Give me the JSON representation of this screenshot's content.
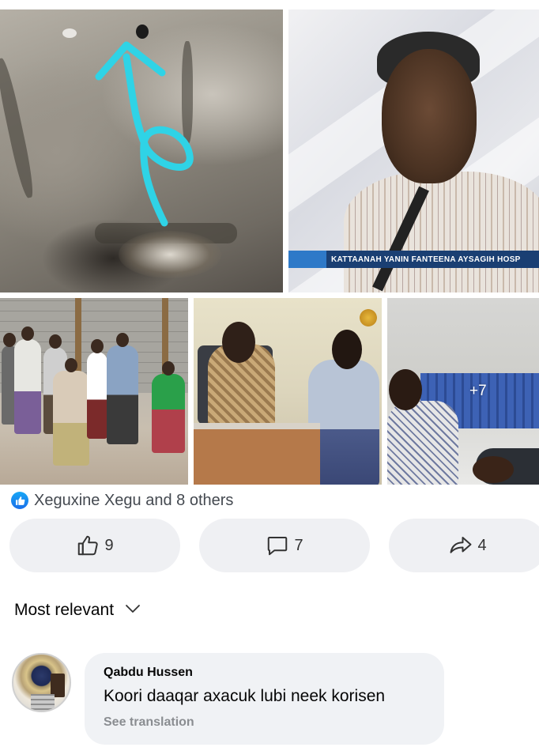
{
  "post": {
    "more_photos_count": "+7",
    "tv_ticker": "KATTAANAH YANIN FANTEENA AYSAGIH HOSP"
  },
  "reactions": {
    "summary": "Xeguxine Xegu and 8 others"
  },
  "actions": {
    "like_count": "9",
    "comment_count": "7",
    "share_count": "4"
  },
  "comments_section": {
    "sort_label": "Most relevant"
  },
  "comment": {
    "author": "Qabdu Hussen",
    "text": "Koori daaqar axacuk lubi neek korisen",
    "translate_label": "See translation"
  },
  "colors": {
    "like_blue": "#1877f2",
    "bubble_bg": "#f0f2f5",
    "button_bg": "#eff0f3",
    "arrow_cyan": "#2fd3e6"
  },
  "icons": {
    "like": "thumbs-up-icon",
    "comment": "speech-bubble-icon",
    "share": "share-arrow-icon",
    "sort": "chevron-down-icon"
  }
}
